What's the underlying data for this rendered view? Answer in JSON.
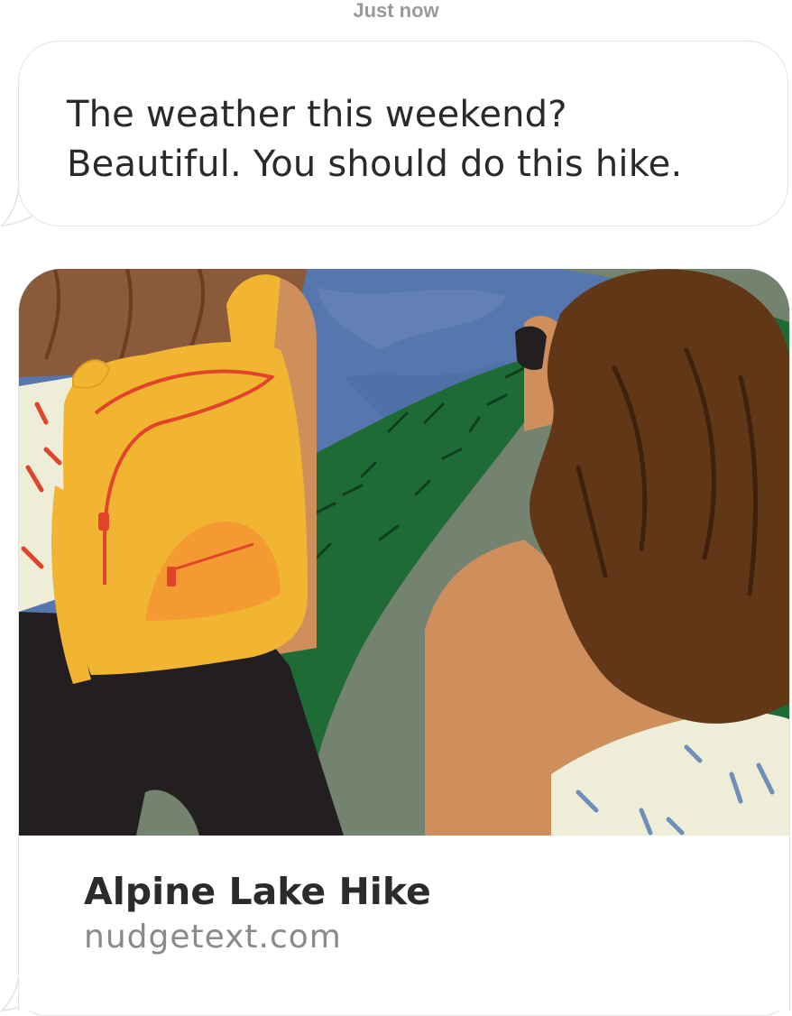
{
  "message": {
    "timestamp": "Just now",
    "lines": [
      "The weather this weekend?",
      "Beautiful. You should do this hike."
    ]
  },
  "link_preview": {
    "title": "Alpine Lake Hike",
    "domain": "nudgetext.com",
    "image_icon": "illustration-hikers-backpack"
  },
  "colors": {
    "bubble_border": "#e3e3e3",
    "message_text": "#2a2a2a",
    "domain_text": "#8a8a8a",
    "timestamp_text": "#9a9a9a",
    "sky": "#5677ad",
    "hills": "#1f6b36",
    "trail": "#74836f",
    "backpack": "#f2b531",
    "pocket": "#f39a33",
    "zipper": "#e2442b",
    "hair_left": "#8a5a3a",
    "hair_right": "#613718",
    "skin": "#cf8f5c",
    "pants": "#231f20",
    "shirt": "#eeedd8",
    "shirt_stripes": "#6d8fb8"
  }
}
